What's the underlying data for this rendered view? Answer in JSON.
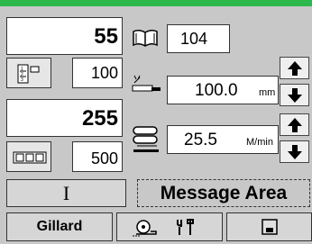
{
  "colors": {
    "topbar": "#2cb84a",
    "panel": "#c8c8c8",
    "field": "#ffffff"
  },
  "counter1": {
    "value": "55",
    "preset": "100",
    "icon": "page-counter-icon"
  },
  "counter2": {
    "value": "255",
    "preset": "500",
    "icon": "number-counter-icon"
  },
  "book": {
    "value": "104",
    "icon": "book-icon"
  },
  "length": {
    "value": "100.0",
    "unit": "mm",
    "icon": "cut-length-icon"
  },
  "speed": {
    "value": "25.5",
    "unit": "M/min",
    "icon": "speed-icon"
  },
  "cursor_button": {
    "label": "I"
  },
  "message_area": {
    "text": "Message Area"
  },
  "bottom": {
    "gillard_label": "Gillard",
    "tools_icon": "tools-icon",
    "disk_icon": "disk-icon"
  }
}
